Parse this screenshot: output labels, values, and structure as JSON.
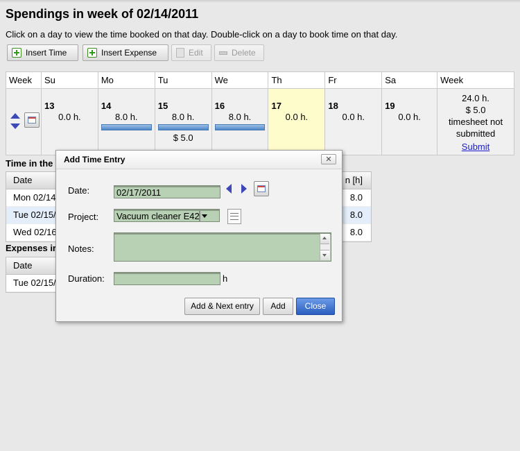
{
  "page": {
    "title": "Spendings in week of 02/14/2011",
    "instructions": "Click on a day to view the time booked on that day. Double-click on a day to book time on that day."
  },
  "toolbar": {
    "insert_time": "Insert Time",
    "insert_expense": "Insert Expense",
    "edit": "Edit",
    "delete": "Delete"
  },
  "week": {
    "headers": [
      "Week",
      "Su",
      "Mo",
      "Tu",
      "We",
      "Th",
      "Fr",
      "Sa",
      "Week"
    ],
    "days": [
      {
        "num": "13",
        "hours": "0.0 h.",
        "bar": false,
        "expense": ""
      },
      {
        "num": "14",
        "hours": "8.0 h.",
        "bar": true,
        "expense": ""
      },
      {
        "num": "15",
        "hours": "8.0 h.",
        "bar": true,
        "expense": "$ 5.0"
      },
      {
        "num": "16",
        "hours": "8.0 h.",
        "bar": true,
        "expense": ""
      },
      {
        "num": "17",
        "hours": "0.0 h.",
        "bar": false,
        "expense": ""
      },
      {
        "num": "18",
        "hours": "0.0 h.",
        "bar": false,
        "expense": ""
      },
      {
        "num": "19",
        "hours": "0.0 h.",
        "bar": false,
        "expense": ""
      }
    ],
    "summary": {
      "hours": "24.0 h.",
      "expense": "$ 5.0",
      "status1": "timesheet not",
      "status2": "submitted",
      "submit": "Submit"
    }
  },
  "time_section": {
    "title": "Time in the",
    "col_date": "Date",
    "col_duration": "n [h]",
    "rows": [
      {
        "date": "Mon 02/14/",
        "duration": "8.0"
      },
      {
        "date": "Tue 02/15/",
        "duration": "8.0"
      },
      {
        "date": "Wed 02/16",
        "duration": "8.0"
      }
    ]
  },
  "expense_section": {
    "title": "Expenses ir",
    "col_date": "Date",
    "rows": [
      {
        "date": "Tue 02/15/"
      }
    ]
  },
  "dialog": {
    "title": "Add Time Entry",
    "close": "✕",
    "date_label": "Date:",
    "date_value": "02/17/2011",
    "project_label": "Project:",
    "project_value": "Vacuum cleaner E42",
    "notes_label": "Notes:",
    "notes_value": "",
    "duration_label": "Duration:",
    "duration_value": "",
    "duration_unit": "h",
    "btn_add_next": "Add & Next entry",
    "btn_add": "Add",
    "btn_close": "Close"
  }
}
